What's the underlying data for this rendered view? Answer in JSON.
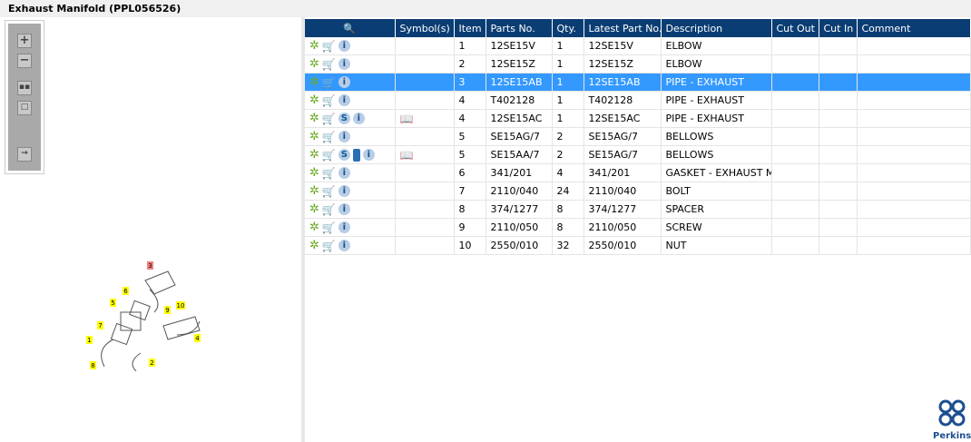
{
  "title": "Exhaust Manifold (PPL056526)",
  "toolbar": {
    "zoom_in": "+",
    "zoom_out": "−",
    "fit": "fit",
    "frame": "frame",
    "export": "export"
  },
  "columns": [
    "",
    "Symbol(s)",
    "Item",
    "Parts No.",
    "Qty.",
    "Latest Part No.",
    "Description",
    "Cut Out",
    "Cut In",
    "Comment"
  ],
  "rows": [
    {
      "item": "1",
      "part": "12SE15V",
      "qty": "1",
      "latest": "12SE15V",
      "desc": "ELBOW",
      "s": false,
      "book": false,
      "symbol": false
    },
    {
      "item": "2",
      "part": "12SE15Z",
      "qty": "1",
      "latest": "12SE15Z",
      "desc": "ELBOW",
      "s": false,
      "book": false,
      "symbol": false
    },
    {
      "item": "3",
      "part": "12SE15AB",
      "qty": "1",
      "latest": "12SE15AB",
      "desc": "PIPE - EXHAUST",
      "s": false,
      "book": false,
      "symbol": false,
      "selected": true
    },
    {
      "item": "4",
      "part": "T402128",
      "qty": "1",
      "latest": "T402128",
      "desc": "PIPE - EXHAUST",
      "s": false,
      "book": false,
      "symbol": false
    },
    {
      "item": "4",
      "part": "12SE15AC",
      "qty": "1",
      "latest": "12SE15AC",
      "desc": "PIPE - EXHAUST",
      "s": true,
      "book": false,
      "symbol": true
    },
    {
      "item": "5",
      "part": "SE15AG/7",
      "qty": "2",
      "latest": "SE15AG/7",
      "desc": "BELLOWS",
      "s": false,
      "book": false,
      "symbol": false
    },
    {
      "item": "5",
      "part": "SE15AA/7",
      "qty": "2",
      "latest": "SE15AG/7",
      "desc": "BELLOWS",
      "s": true,
      "book": true,
      "symbol": true
    },
    {
      "item": "6",
      "part": "341/201",
      "qty": "4",
      "latest": "341/201",
      "desc": "GASKET - EXHAUST MANIFOLD",
      "s": false,
      "book": false,
      "symbol": false
    },
    {
      "item": "7",
      "part": "2110/040",
      "qty": "24",
      "latest": "2110/040",
      "desc": "BOLT",
      "s": false,
      "book": false,
      "symbol": false
    },
    {
      "item": "8",
      "part": "374/1277",
      "qty": "8",
      "latest": "374/1277",
      "desc": "SPACER",
      "s": false,
      "book": false,
      "symbol": false
    },
    {
      "item": "9",
      "part": "2110/050",
      "qty": "8",
      "latest": "2110/050",
      "desc": "SCREW",
      "s": false,
      "book": false,
      "symbol": false
    },
    {
      "item": "10",
      "part": "2550/010",
      "qty": "32",
      "latest": "2550/010",
      "desc": "NUT",
      "s": false,
      "book": false,
      "symbol": false
    }
  ],
  "diagram_labels": [
    "1",
    "2",
    "3",
    "4",
    "5",
    "6",
    "7",
    "8",
    "9",
    "10"
  ],
  "logo": "Perkins",
  "colors": {
    "header": "#0a3d73",
    "selected": "#3399ff",
    "callout": "#ffff00"
  }
}
